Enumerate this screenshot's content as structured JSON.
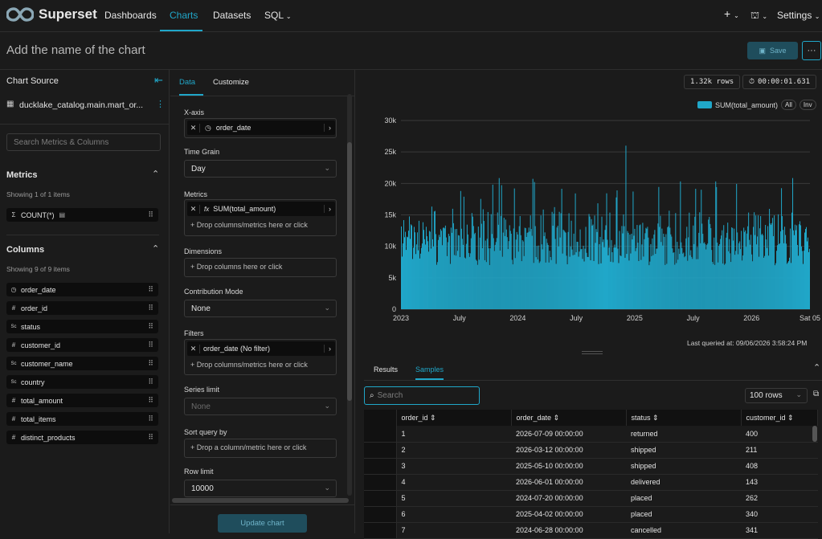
{
  "nav": {
    "brand": "Superset",
    "links": [
      "Dashboards",
      "Charts",
      "Datasets",
      "SQL"
    ],
    "active": "Charts",
    "plus": "+",
    "settings": "Settings"
  },
  "titlebar": {
    "chart_name_placeholder": "Add the name of the chart",
    "save_label": "Save",
    "more_label": "···"
  },
  "source": {
    "heading": "Chart Source",
    "dataset": "ducklake_catalog.main.mart_or...",
    "search_placeholder": "Search Metrics & Columns",
    "metrics_heading": "Metrics",
    "metrics_count": "Showing 1 of 1 items",
    "metrics": [
      {
        "icon": "Σ",
        "name": "COUNT(*)"
      }
    ],
    "columns_heading": "Columns",
    "columns_count": "Showing 9 of 9 items",
    "columns": [
      {
        "icon": "clock",
        "name": "order_date"
      },
      {
        "icon": "#",
        "name": "order_id"
      },
      {
        "icon": "Sc",
        "name": "status"
      },
      {
        "icon": "#",
        "name": "customer_id"
      },
      {
        "icon": "Sc",
        "name": "customer_name"
      },
      {
        "icon": "Sc",
        "name": "country"
      },
      {
        "icon": "#",
        "name": "total_amount"
      },
      {
        "icon": "#",
        "name": "total_items"
      },
      {
        "icon": "#",
        "name": "distinct_products"
      }
    ]
  },
  "config": {
    "tabs": [
      "Data",
      "Customize"
    ],
    "x_axis_label": "X-axis",
    "x_axis_value": "order_date",
    "time_grain_label": "Time Grain",
    "time_grain_value": "Day",
    "metrics_label": "Metrics",
    "metric_value": "SUM(total_amount)",
    "metric_fx": "fx",
    "drop_metrics": "Drop columns/metrics here or click",
    "dimensions_label": "Dimensions",
    "drop_columns": "Drop columns here or click",
    "contribution_label": "Contribution Mode",
    "contribution_value": "None",
    "filters_label": "Filters",
    "filter_value": "order_date (No filter)",
    "drop_filters": "Drop columns/metrics here or click",
    "series_limit_label": "Series limit",
    "series_limit_value": "None",
    "sort_label": "Sort query by",
    "drop_sort": "Drop a column/metric here or click",
    "row_limit_label": "Row limit",
    "row_limit_value": "10000",
    "update_label": "Update chart"
  },
  "result": {
    "rows_badge": "1.32k rows",
    "time_badge": "00:00:01.631",
    "legend_all": "All",
    "legend_inv": "Inv",
    "last_queried": "Last queried at: 09/06/2026 3:58:24 PM",
    "tabs": [
      "Results",
      "Samples"
    ],
    "active_tab": "Samples",
    "search_placeholder": "Search",
    "rows_select": "100 rows",
    "columns": [
      "order_id",
      "order_date",
      "status",
      "customer_id"
    ],
    "rows": [
      [
        "1",
        "2026-07-09 00:00:00",
        "returned",
        "400"
      ],
      [
        "2",
        "2026-03-12 00:00:00",
        "shipped",
        "211"
      ],
      [
        "3",
        "2025-05-10 00:00:00",
        "shipped",
        "408"
      ],
      [
        "4",
        "2026-06-01 00:00:00",
        "delivered",
        "143"
      ],
      [
        "5",
        "2024-07-20 00:00:00",
        "placed",
        "262"
      ],
      [
        "6",
        "2025-04-02 00:00:00",
        "placed",
        "340"
      ],
      [
        "7",
        "2024-06-28 00:00:00",
        "cancelled",
        "341"
      ]
    ]
  },
  "chart_data": {
    "type": "bar",
    "series": [
      {
        "name": "SUM(total_amount)",
        "color": "#20a7c9"
      }
    ],
    "ylim": [
      0,
      30000
    ],
    "yticks": [
      "0",
      "5k",
      "10k",
      "15k",
      "20k",
      "25k",
      "30k"
    ],
    "xticks": [
      "2023",
      "July",
      "2024",
      "July",
      "2025",
      "July",
      "2026",
      "Sat 05"
    ],
    "grid": true,
    "legend": "top-right",
    "note": "Daily values, approximately 1,320 bars; typical range 7k–15k with spikes up to ~26k"
  },
  "colors": {
    "accent": "#20a7c9",
    "bg": "#1b1b1b"
  }
}
